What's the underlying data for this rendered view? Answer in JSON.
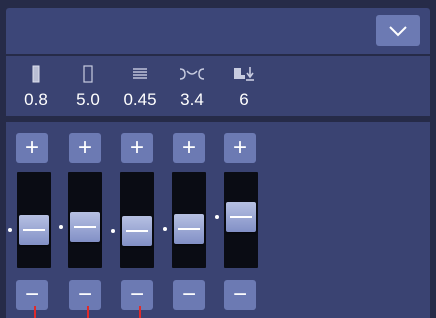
{
  "header": {
    "collapse_icon": "chevron-down-icon"
  },
  "readouts": [
    {
      "name": "stitch-width",
      "icon": "stitch-width-icon",
      "value": "0.8"
    },
    {
      "name": "stitch-length",
      "icon": "stitch-length-icon",
      "value": "5.0"
    },
    {
      "name": "stitch-density",
      "icon": "stitch-density-icon",
      "value": "0.45"
    },
    {
      "name": "thread-tension",
      "icon": "tension-icon",
      "value": "3.4"
    },
    {
      "name": "presser-foot-pressure",
      "icon": "presser-foot-icon",
      "value": "6"
    }
  ],
  "controls": {
    "plus_label": "+",
    "minus_label": "−",
    "slider_levels": [
      0.35,
      0.4,
      0.33,
      0.37,
      0.55
    ]
  },
  "colors": {
    "background": "#262b48",
    "panel": "#3a4372",
    "button": "#6c7ab3",
    "track": "#0a0c14",
    "indicator": "#e02a2a"
  }
}
